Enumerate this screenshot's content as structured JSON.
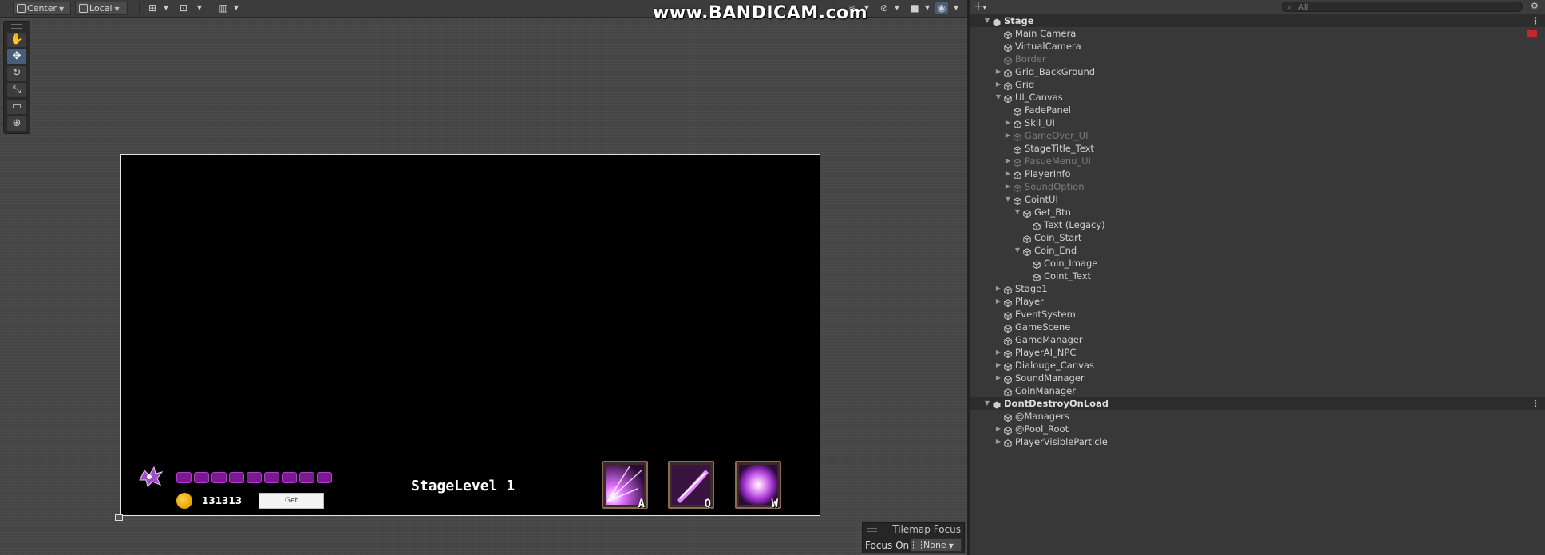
{
  "scene_toolbar": {
    "pivot_mode": "Center",
    "pivot_rotation": "Local"
  },
  "watermark": {
    "text": "www.BANDICAM.com"
  },
  "tools": [
    "hand-tool",
    "move-tool",
    "rotate-tool",
    "scale-tool",
    "rect-tool",
    "transform-tool"
  ],
  "game_ui": {
    "hp_segments": 9,
    "coin_count": "131313",
    "get_button": "Get",
    "stage_title": "StageLevel 1",
    "skills": [
      {
        "key": "A",
        "icon": "burst-skill-icon"
      },
      {
        "key": "Q",
        "icon": "slash-skill-icon"
      },
      {
        "key": "W",
        "icon": "nova-skill-icon"
      }
    ]
  },
  "tilemap_focus": {
    "title": "Tilemap Focus",
    "label": "Focus On",
    "value": "None"
  },
  "hierarchy": {
    "search_placeholder": "All",
    "rows": [
      {
        "name": "Stage",
        "depth": 0,
        "scene": true,
        "fold": "open",
        "menu": true
      },
      {
        "name": "Main Camera",
        "depth": 1,
        "fold": "none",
        "warn": true
      },
      {
        "name": "VirtualCamera",
        "depth": 1,
        "fold": "none"
      },
      {
        "name": "Border",
        "depth": 1,
        "fold": "none",
        "inactive": true
      },
      {
        "name": "Grid_BackGround",
        "depth": 1,
        "fold": "closed"
      },
      {
        "name": "Grid",
        "depth": 1,
        "fold": "closed"
      },
      {
        "name": "UI_Canvas",
        "depth": 1,
        "fold": "open"
      },
      {
        "name": "FadePanel",
        "depth": 2,
        "fold": "none"
      },
      {
        "name": "Skil_UI",
        "depth": 2,
        "fold": "closed"
      },
      {
        "name": "GameOver_UI",
        "depth": 2,
        "fold": "closed",
        "inactive": true
      },
      {
        "name": "StageTitle_Text",
        "depth": 2,
        "fold": "none"
      },
      {
        "name": "PasueMenu_UI",
        "depth": 2,
        "fold": "closed",
        "inactive": true
      },
      {
        "name": "PlayerInfo",
        "depth": 2,
        "fold": "closed"
      },
      {
        "name": "SoundOption",
        "depth": 2,
        "fold": "closed",
        "inactive": true
      },
      {
        "name": "CointUI",
        "depth": 2,
        "fold": "open"
      },
      {
        "name": "Get_Btn",
        "depth": 3,
        "fold": "open"
      },
      {
        "name": "Text (Legacy)",
        "depth": 4,
        "fold": "none"
      },
      {
        "name": "Coin_Start",
        "depth": 3,
        "fold": "none"
      },
      {
        "name": "Coin_End",
        "depth": 3,
        "fold": "open"
      },
      {
        "name": "Coin_Image",
        "depth": 4,
        "fold": "none"
      },
      {
        "name": "Coint_Text",
        "depth": 4,
        "fold": "none"
      },
      {
        "name": "Stage1",
        "depth": 1,
        "fold": "closed"
      },
      {
        "name": "Player",
        "depth": 1,
        "fold": "closed"
      },
      {
        "name": "EventSystem",
        "depth": 1,
        "fold": "none"
      },
      {
        "name": "GameScene",
        "depth": 1,
        "fold": "none"
      },
      {
        "name": "GameManager",
        "depth": 1,
        "fold": "none"
      },
      {
        "name": "PlayerAI_NPC",
        "depth": 1,
        "fold": "closed"
      },
      {
        "name": "Dialouge_Canvas",
        "depth": 1,
        "fold": "closed"
      },
      {
        "name": "SoundManager",
        "depth": 1,
        "fold": "closed"
      },
      {
        "name": "CoinManager",
        "depth": 1,
        "fold": "none"
      },
      {
        "name": "DontDestroyOnLoad",
        "depth": 0,
        "scene": true,
        "fold": "open",
        "menu": true
      },
      {
        "name": "@Managers",
        "depth": 1,
        "fold": "none"
      },
      {
        "name": "@Pool_Root",
        "depth": 1,
        "fold": "closed"
      },
      {
        "name": "PlayerVisibleParticle",
        "depth": 1,
        "fold": "closed"
      }
    ]
  }
}
